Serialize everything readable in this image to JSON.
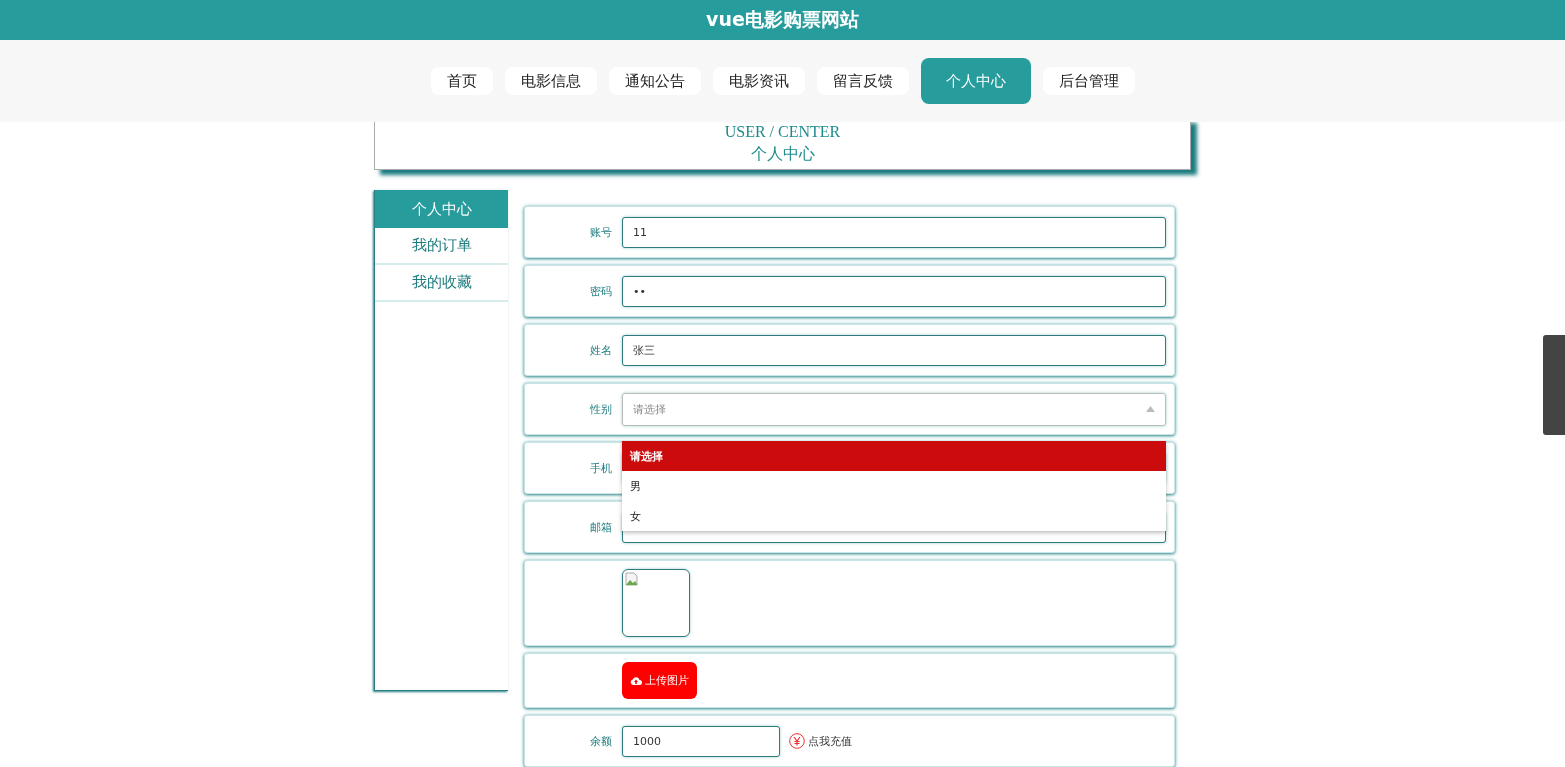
{
  "site_title": "vue电影购票网站",
  "nav": [
    {
      "label": "首页",
      "selected": false
    },
    {
      "label": "电影信息",
      "selected": false
    },
    {
      "label": "通知公告",
      "selected": false
    },
    {
      "label": "电影资讯",
      "selected": false
    },
    {
      "label": "留言反馈",
      "selected": false
    },
    {
      "label": "个人中心",
      "selected": true
    },
    {
      "label": "后台管理",
      "selected": false
    }
  ],
  "section_title": {
    "en": "USER / CENTER",
    "zh": "个人中心"
  },
  "sidebar": [
    {
      "label": "个人中心",
      "selected": true
    },
    {
      "label": "我的订单",
      "selected": false
    },
    {
      "label": "我的收藏",
      "selected": false
    }
  ],
  "fields": [
    {
      "kind": "input",
      "label": "账号",
      "value": "11"
    },
    {
      "kind": "input",
      "label": "密码",
      "value": "••"
    },
    {
      "kind": "input",
      "label": "姓名",
      "value": "张三"
    },
    {
      "kind": "select",
      "label": "性别",
      "placeholder": "请选择",
      "expanded": true,
      "options": [
        {
          "label": "请选择",
          "selected": true
        },
        {
          "label": "男",
          "selected": false
        },
        {
          "label": "女",
          "selected": false
        }
      ]
    },
    {
      "kind": "input",
      "label": "手机"
    },
    {
      "kind": "input",
      "label": "邮箱"
    },
    {
      "kind": "image"
    },
    {
      "kind": "upload",
      "button": "上传图片"
    },
    {
      "kind": "balance",
      "label": "余额",
      "value": "1000",
      "link": "点我充值"
    }
  ]
}
